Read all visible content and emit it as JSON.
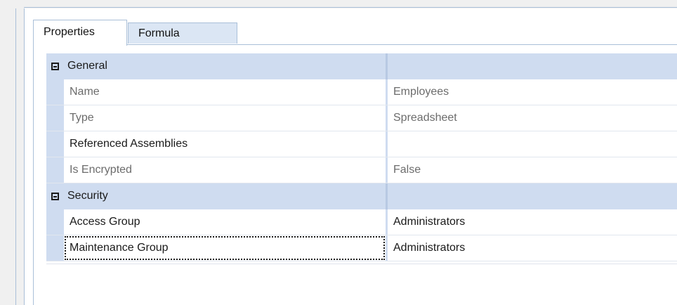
{
  "tabs": [
    {
      "label": "Properties",
      "active": true
    },
    {
      "label": "Formula",
      "active": false
    }
  ],
  "categories": [
    {
      "label": "General",
      "expanded": true,
      "rows": [
        {
          "name": "Name",
          "value": "Employees",
          "readonly": true
        },
        {
          "name": "Type",
          "value": "Spreadsheet",
          "readonly": true
        },
        {
          "name": "Referenced Assemblies",
          "value": "",
          "readonly": false
        },
        {
          "name": "Is Encrypted",
          "value": "False",
          "readonly": true
        }
      ]
    },
    {
      "label": "Security",
      "expanded": true,
      "rows": [
        {
          "name": "Access Group",
          "value": "Administrators",
          "readonly": false
        },
        {
          "name": "Maintenance Group",
          "value": "Administrators",
          "readonly": false,
          "focused": true
        }
      ]
    }
  ],
  "colors": {
    "category_bg": "#cfdcf0",
    "border": "#a9bfd8",
    "inactive_tab": "#dbe6f4",
    "readonly_text": "#6c6c6c"
  }
}
